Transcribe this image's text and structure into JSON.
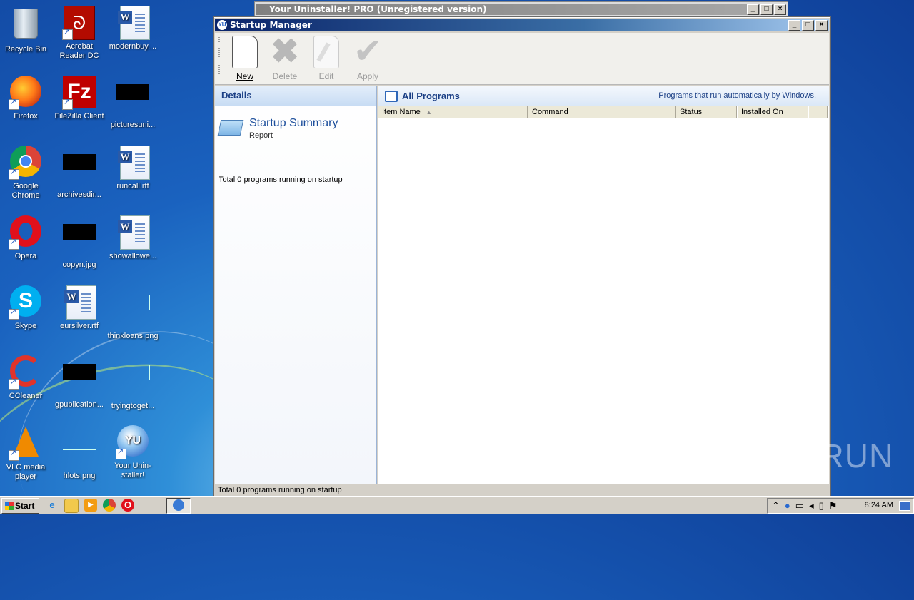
{
  "desktop": {
    "icons": [
      {
        "label": "Recycle Bin"
      },
      {
        "label": "Acrobat Reader DC"
      },
      {
        "label": "modernbuy...."
      },
      {
        "label": "Firefox"
      },
      {
        "label": "FileZilla Client"
      },
      {
        "label": "picturesuni..."
      },
      {
        "label": "Google Chrome"
      },
      {
        "label": "archivesdir..."
      },
      {
        "label": "runcall.rtf"
      },
      {
        "label": "Opera"
      },
      {
        "label": "copyn.jpg"
      },
      {
        "label": "showallowe..."
      },
      {
        "label": "Skype"
      },
      {
        "label": "eursilver.rtf"
      },
      {
        "label": "thinkloans.png"
      },
      {
        "label": "CCleaner"
      },
      {
        "label": "gpublication..."
      },
      {
        "label": "tryingtoget..."
      },
      {
        "label": "VLC media player"
      },
      {
        "label": "hlots.png"
      },
      {
        "label": "Your Unin-staller!"
      }
    ]
  },
  "background_window": {
    "title": "Your Uninstaller! PRO (Unregistered version)"
  },
  "window": {
    "title": "Startup Manager",
    "toolbar": {
      "new": "New",
      "delete": "Delete",
      "edit": "Edit",
      "apply": "Apply"
    },
    "details": {
      "header": "Details",
      "summary_title": "Startup Summary",
      "summary_sub": "Report",
      "total": "Total 0 programs running on startup"
    },
    "programs": {
      "header": "All Programs",
      "description": "Programs that run automatically by Windows.",
      "columns": [
        "Item Name",
        "Command",
        "Status",
        "Installed On"
      ],
      "rows": []
    },
    "status_text": "Total 0 programs running on startup"
  },
  "taskbar": {
    "start": "Start",
    "clock": "8:24 AM"
  },
  "watermark": "ANY RUN",
  "colors": {
    "desktop_blue": "#1a62bf",
    "title_blue": "#0a246a",
    "accent_text": "#1b3f85"
  }
}
